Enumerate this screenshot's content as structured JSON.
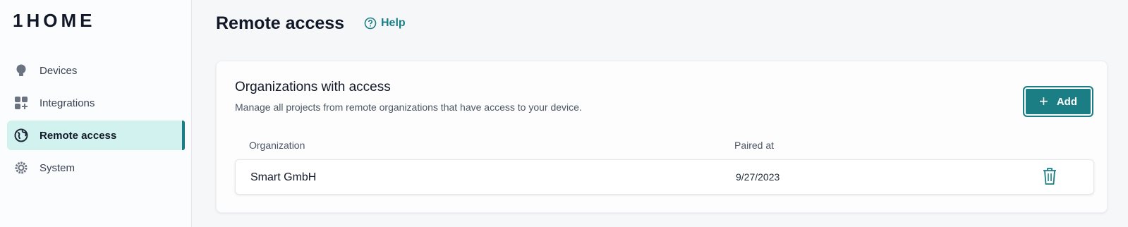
{
  "app": {
    "logo_text": "1HOME"
  },
  "sidebar": {
    "items": [
      {
        "label": "Devices",
        "icon": "lightbulb-icon"
      },
      {
        "label": "Integrations",
        "icon": "integrations-icon"
      },
      {
        "label": "Remote access",
        "icon": "globe-icon",
        "active": true
      },
      {
        "label": "System",
        "icon": "gear-icon"
      }
    ]
  },
  "header": {
    "title": "Remote access",
    "help_label": "Help"
  },
  "card": {
    "title": "Organizations with access",
    "subtitle": "Manage all projects from remote organizations that have access to your device.",
    "add_label": "Add",
    "columns": [
      "Organization",
      "Paired at"
    ],
    "rows": [
      {
        "organization": "Smart GmbH",
        "paired_at": "9/27/2023"
      }
    ]
  },
  "colors": {
    "accent": "#1b7e85",
    "active_bg": "#d2f2ef",
    "page_bg": "#f5f7f9"
  }
}
